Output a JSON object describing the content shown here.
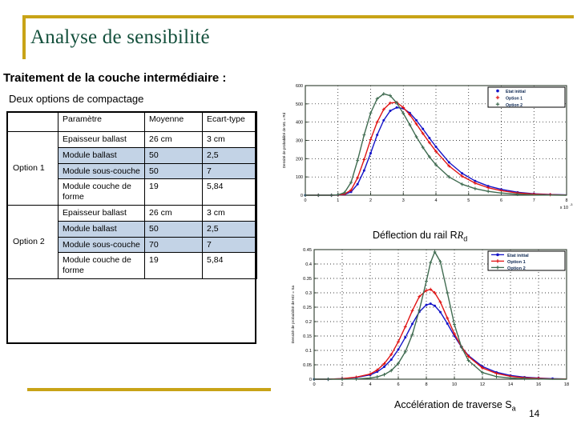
{
  "slide": {
    "title": "Analyse de sensibilité",
    "subtitle_heading": "Traitement de la couche intermédiaire :",
    "subtitle_note": "Deux options de compactage",
    "page_number": "14",
    "accent_color": "#c8a317",
    "title_color": "#14503c",
    "highlight_color": "#c3d3e6"
  },
  "table": {
    "headers": [
      "",
      "Paramètre",
      "Moyenne",
      "Ecart-type"
    ],
    "groups": [
      {
        "label": "Option 1",
        "rows": [
          {
            "param": "Epaisseur ballast",
            "moyenne": "26 cm",
            "ecart": "3 cm",
            "highlight": false
          },
          {
            "param": "Module ballast",
            "moyenne": "50",
            "ecart": "2,5",
            "highlight": true
          },
          {
            "param": "Module sous-couche",
            "moyenne": "50",
            "ecart": "7",
            "highlight": true
          },
          {
            "param": "Module couche de forme",
            "moyenne": "19",
            "ecart": "5,84",
            "highlight": false
          }
        ]
      },
      {
        "label": "Option 2",
        "rows": [
          {
            "param": "Epaisseur ballast",
            "moyenne": "26 cm",
            "ecart": "3 cm",
            "highlight": false
          },
          {
            "param": "Module ballast",
            "moyenne": "50",
            "ecart": "2,5",
            "highlight": true
          },
          {
            "param": "Module sous-couche",
            "moyenne": "70",
            "ecart": "7",
            "highlight": true
          },
          {
            "param": "Module couche de forme",
            "moyenne": "19",
            "ecart": "5,84",
            "highlight": false
          }
        ]
      }
    ]
  },
  "captions": {
    "top": "Déflection du rail R",
    "top_sub": "d",
    "bottom": "Accélération de traverse S",
    "bottom_sub": "a"
  },
  "chart_data": [
    {
      "id": "rail-deflection-pdf",
      "type": "line",
      "title": "",
      "xlabel": "Déflection du rail Rd",
      "ylabel": "Densité de probabilité de M1 = Rd",
      "x_multiplier": "x 10^-3",
      "xlim": [
        0,
        8
      ],
      "ylim": [
        0,
        600
      ],
      "xticks": [
        0,
        1,
        2,
        3,
        4,
        5,
        6,
        7,
        8
      ],
      "yticks": [
        0,
        100,
        200,
        300,
        400,
        500,
        600
      ],
      "grid": true,
      "legend_position": "top-right",
      "legend": [
        "Etat initial",
        "Option 1",
        "Option 2"
      ],
      "colors": [
        "#1414c8",
        "#e01414",
        "#3f6b50"
      ],
      "x": [
        0,
        0.4,
        0.8,
        1.0,
        1.2,
        1.4,
        1.6,
        1.8,
        2.0,
        2.2,
        2.4,
        2.6,
        2.8,
        3.0,
        3.2,
        3.4,
        3.6,
        3.8,
        4.0,
        4.4,
        4.8,
        5.2,
        5.6,
        6.0,
        6.5,
        7.0,
        7.5,
        8.0
      ],
      "series": [
        {
          "name": "Etat initial",
          "values": [
            0,
            0,
            0,
            1,
            4,
            18,
            60,
            135,
            230,
            330,
            410,
            462,
            480,
            475,
            450,
            410,
            363,
            313,
            265,
            180,
            120,
            78,
            50,
            32,
            16,
            8,
            4,
            2
          ]
        },
        {
          "name": "Option 1",
          "values": [
            0,
            0,
            0,
            1,
            6,
            28,
            95,
            195,
            305,
            400,
            470,
            505,
            508,
            480,
            440,
            390,
            338,
            288,
            240,
            160,
            104,
            66,
            41,
            25,
            12,
            6,
            3,
            1
          ]
        },
        {
          "name": "Option 2",
          "values": [
            0,
            0,
            0,
            2,
            14,
            70,
            190,
            330,
            450,
            528,
            555,
            545,
            505,
            448,
            385,
            320,
            262,
            210,
            166,
            100,
            60,
            36,
            21,
            12,
            5,
            2,
            1,
            0
          ]
        }
      ]
    },
    {
      "id": "sleeper-acceleration-pdf",
      "type": "line",
      "title": "",
      "xlabel": "Accélération de traverse Sa",
      "ylabel": "Densité de probabilité de M2 = Sa",
      "xlim": [
        0,
        18
      ],
      "ylim": [
        0,
        0.45
      ],
      "xticks": [
        0,
        2,
        4,
        6,
        8,
        10,
        12,
        14,
        16,
        18
      ],
      "yticks": [
        0,
        0.05,
        0.1,
        0.15,
        0.2,
        0.25,
        0.3,
        0.35,
        0.4,
        0.45
      ],
      "grid": true,
      "legend_position": "top-right",
      "legend": [
        "Etat initial",
        "Option 1",
        "Option 2"
      ],
      "colors": [
        "#1414c8",
        "#e01414",
        "#3f6b50"
      ],
      "x": [
        0,
        1,
        2,
        3,
        4,
        4.5,
        5,
        5.5,
        6,
        6.5,
        7,
        7.5,
        8,
        8.3,
        8.6,
        9,
        9.5,
        10,
        10.5,
        11,
        12,
        13,
        14,
        15,
        16,
        17,
        18
      ],
      "series": [
        {
          "name": "Etat initial",
          "values": [
            0,
            0,
            0.002,
            0.006,
            0.015,
            0.026,
            0.043,
            0.068,
            0.103,
            0.145,
            0.192,
            0.234,
            0.258,
            0.262,
            0.255,
            0.233,
            0.193,
            0.15,
            0.112,
            0.082,
            0.044,
            0.024,
            0.013,
            0.007,
            0.004,
            0.002,
            0.001
          ]
        },
        {
          "name": "Option 1",
          "values": [
            0,
            0,
            0.002,
            0.007,
            0.018,
            0.032,
            0.054,
            0.086,
            0.13,
            0.182,
            0.238,
            0.287,
            0.308,
            0.312,
            0.3,
            0.268,
            0.212,
            0.158,
            0.113,
            0.079,
            0.039,
            0.02,
            0.01,
            0.005,
            0.003,
            0.001,
            0.001
          ]
        },
        {
          "name": "Option 2",
          "values": [
            0,
            0,
            0,
            0.001,
            0.004,
            0.008,
            0.016,
            0.03,
            0.055,
            0.095,
            0.155,
            0.24,
            0.34,
            0.405,
            0.442,
            0.408,
            0.3,
            0.19,
            0.112,
            0.065,
            0.023,
            0.009,
            0.004,
            0.002,
            0.001,
            0,
            0
          ]
        }
      ]
    }
  ]
}
